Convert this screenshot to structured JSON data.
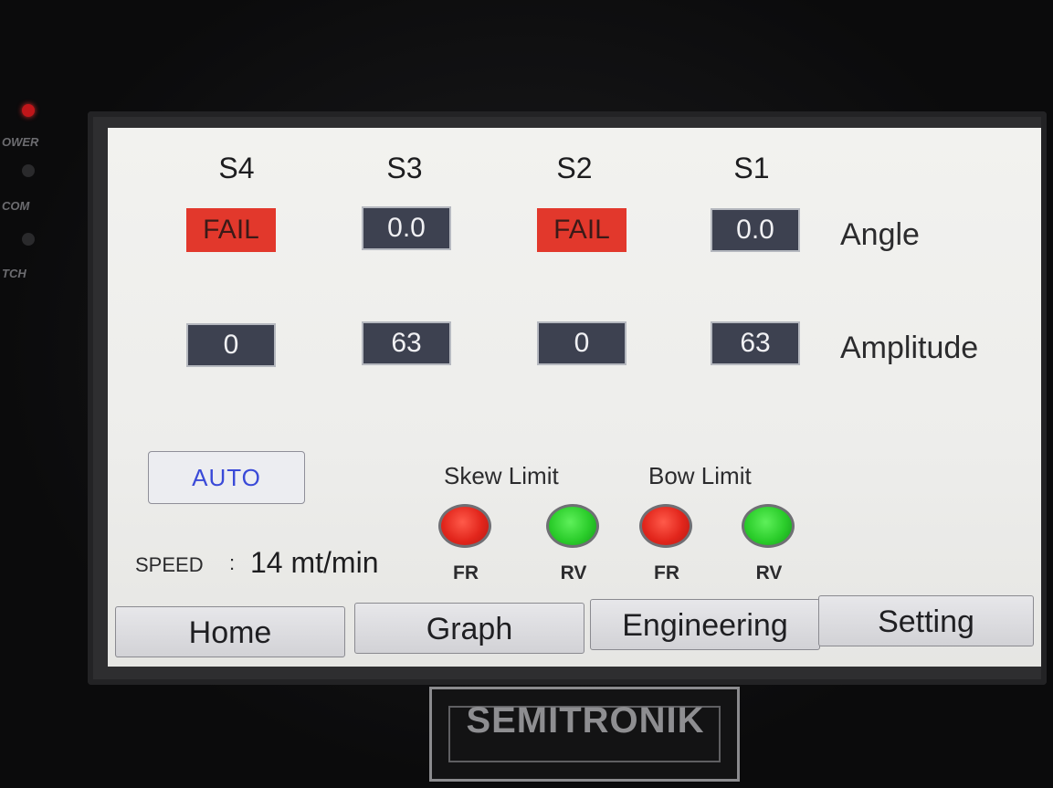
{
  "device": {
    "indicators": [
      {
        "label": "OWER",
        "color": "#c0161a"
      },
      {
        "label": "COM",
        "color": "#2a2a2c"
      },
      {
        "label": "TCH",
        "color": "#2a2a2c"
      }
    ],
    "logo_text": "SEMITRONIK"
  },
  "sensors": {
    "headers": [
      "S4",
      "S3",
      "S2",
      "S1"
    ],
    "angle": {
      "label": "Angle",
      "values": [
        "FAIL",
        "0.0",
        "FAIL",
        "0.0"
      ],
      "status": [
        "fail",
        "ok",
        "fail",
        "ok"
      ]
    },
    "amplitude": {
      "label": "Amplitude",
      "values": [
        "0",
        "63",
        "0",
        "63"
      ]
    }
  },
  "controls": {
    "mode_button": "AUTO",
    "speed_label": "SPEED",
    "speed_separator": ":",
    "speed_value": "14 mt/min"
  },
  "limits": {
    "skew_label": "Skew Limit",
    "bow_label": "Bow Limit",
    "lamps": [
      {
        "caption": "FR",
        "state": "red",
        "color": "#e2261c"
      },
      {
        "caption": "RV",
        "state": "green",
        "color": "#2bcd2b"
      },
      {
        "caption": "FR",
        "state": "red",
        "color": "#e2261c"
      },
      {
        "caption": "RV",
        "state": "green",
        "color": "#2bcd2b"
      }
    ]
  },
  "nav": {
    "items": [
      "Home",
      "Graph",
      "Engineering",
      "Setting"
    ]
  },
  "colors": {
    "fail_bg": "#e2382c",
    "value_box_bg": "#3d4150",
    "auto_text": "#3a4ad8"
  }
}
